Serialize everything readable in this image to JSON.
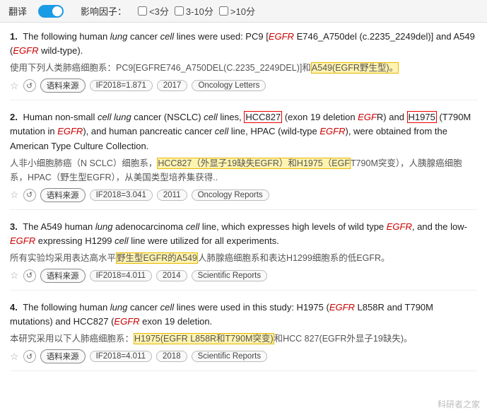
{
  "topbar": {
    "translate_label": "翻译",
    "influence_label": "影响因子：",
    "filter1": "<3分",
    "filter2": "3-10分",
    "filter3": ">10分"
  },
  "results": [
    {
      "num": "1.",
      "en_parts": [
        {
          "text": "The following human "
        },
        {
          "text": "lung",
          "style": "italic"
        },
        {
          "text": " cancer "
        },
        {
          "text": "cell",
          "style": "italic"
        },
        {
          "text": " lines were used: PC9 ["
        },
        {
          "text": "EGFR",
          "style": "italic red"
        },
        {
          "text": " E746_A750del (c.2235_2249del)] and A549 ("
        },
        {
          "text": "EGFR",
          "style": "italic red"
        },
        {
          "text": " wild-type)."
        }
      ],
      "cn_parts": [
        {
          "text": "使用下列人类肺癌细胞系：PC9[EGFRE746_A750DEL(C.2235_2249DEL)]和"
        },
        {
          "text": "A549(EGFR野生型)。",
          "style": "highlight"
        }
      ],
      "if_value": "IF2018=1.871",
      "year": "2017",
      "source": "Oncology Letters"
    },
    {
      "num": "2.",
      "en_parts": [
        {
          "text": "Human non-small "
        },
        {
          "text": "cell",
          "style": "italic"
        },
        {
          "text": " "
        },
        {
          "text": "lung",
          "style": "italic"
        },
        {
          "text": " cancer (NSCLC) "
        },
        {
          "text": "cell",
          "style": "italic"
        },
        {
          "text": " lines, "
        },
        {
          "text": "HCC827",
          "style": "red-box"
        },
        {
          "text": " (exon 19 deletion "
        },
        {
          "text": "EGF",
          "style": "italic red"
        },
        {
          "text": "\nR) and "
        },
        {
          "text": "H1975",
          "style": "red-box"
        },
        {
          "text": " (T790M mutation in "
        },
        {
          "text": "EGFR",
          "style": "italic red"
        },
        {
          "text": "), and human pancreatic cancer "
        },
        {
          "text": "cell",
          "style": "italic"
        },
        {
          "text": " line, HPAC\n(wild-type "
        },
        {
          "text": "EGFR",
          "style": "italic red"
        },
        {
          "text": "), were obtained from the American Type Culture Collection."
        }
      ],
      "cn_parts": [
        {
          "text": "人非小细胞肺癌（N SCLC）细胞系，"
        },
        {
          "text": "HCC827（外显子19缺失EGFR）和H1975（EGF",
          "style": "highlight"
        },
        {
          "text": "T790M突\n变），人胰腺癌细胞系，HPAC（野生型EGFR），从美国类型培养集获得.."
        }
      ],
      "if_value": "IF2018=3.041",
      "year": "2011",
      "source": "Oncology Reports"
    },
    {
      "num": "3.",
      "en_parts": [
        {
          "text": "The A549 human "
        },
        {
          "text": "lung",
          "style": "italic"
        },
        {
          "text": " adenocarcinoma "
        },
        {
          "text": "cell",
          "style": "italic"
        },
        {
          "text": " line, which expresses high levels of wild typ\ne "
        },
        {
          "text": "EGFR",
          "style": "italic red"
        },
        {
          "text": ", and the low-"
        },
        {
          "text": "EGFR",
          "style": "italic red"
        },
        {
          "text": " expressing H1299 "
        },
        {
          "text": "cell",
          "style": "italic"
        },
        {
          "text": " line were utilized for all experiments."
        }
      ],
      "cn_parts": [
        {
          "text": "所有实验均采用表达高水平"
        },
        {
          "text": "野生型EGFR的A549",
          "style": "highlight"
        },
        {
          "text": "人肺腺癌细胞系和表达H1299细胞系的低EGFR。"
        }
      ],
      "if_value": "IF2018=4.011",
      "year": "2014",
      "source": "Scientific Reports"
    },
    {
      "num": "4.",
      "en_parts": [
        {
          "text": "The following human "
        },
        {
          "text": "lung",
          "style": "italic"
        },
        {
          "text": " cancer "
        },
        {
          "text": "cell",
          "style": "italic"
        },
        {
          "text": " lines were used in this study: H1975 ("
        },
        {
          "text": "EGFR",
          "style": "italic red"
        },
        {
          "text": " L858\nR and T790M mutations) and HCC827 ("
        },
        {
          "text": "EGFR",
          "style": "italic red"
        },
        {
          "text": " exon 19 deletion."
        }
      ],
      "cn_parts": [
        {
          "text": "本研究采用以下人肺癌细胞系："
        },
        {
          "text": "H1975(EGFR L858R和T790M突变)",
          "style": "highlight"
        },
        {
          "text": "和HCC 827(EGFR外显子19缺\n失)。"
        }
      ],
      "if_value": "IF2018=4.011",
      "year": "2018",
      "source": "Scientific Reports"
    }
  ],
  "watermark": "科研者之家"
}
